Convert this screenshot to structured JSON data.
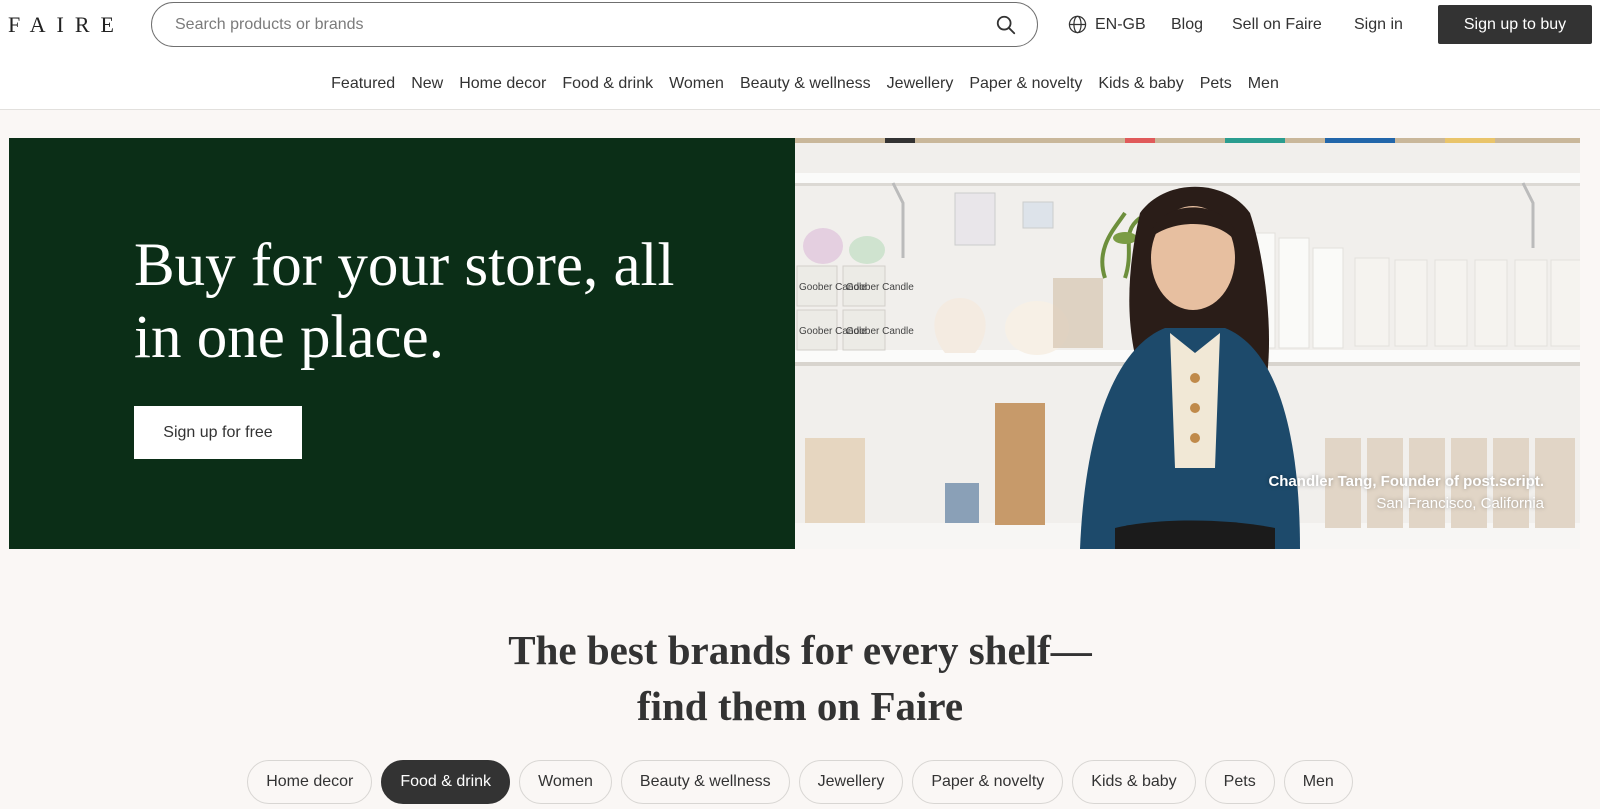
{
  "header": {
    "logo": "FAIRE",
    "search_placeholder": "Search products or brands",
    "language": "EN-GB",
    "blog": "Blog",
    "sell": "Sell on Faire",
    "sign_in": "Sign in",
    "sign_up": "Sign up to buy"
  },
  "nav": {
    "items": [
      "Featured",
      "New",
      "Home decor",
      "Food & drink",
      "Women",
      "Beauty & wellness",
      "Jewellery",
      "Paper & novelty",
      "Kids & baby",
      "Pets",
      "Men"
    ]
  },
  "hero": {
    "title": "Buy for your store, all in one place.",
    "cta": "Sign up for free",
    "caption_name": "Chandler Tang, Founder of post.script.",
    "caption_location": "San Francisco, California",
    "product_label_1": "Goober Candle",
    "product_label_2": "Goober Candle",
    "product_label_3": "Goober Candle",
    "product_label_4": "Goober Candle",
    "colors": {
      "green": "#0b2e17"
    }
  },
  "section": {
    "title_line1": "The best brands for every shelf—",
    "title_line2": "find them on Faire",
    "pills": [
      "Home decor",
      "Food & drink",
      "Women",
      "Beauty & wellness",
      "Jewellery",
      "Paper & novelty",
      "Kids & baby",
      "Pets",
      "Men"
    ],
    "active_pill": "Food & drink"
  }
}
